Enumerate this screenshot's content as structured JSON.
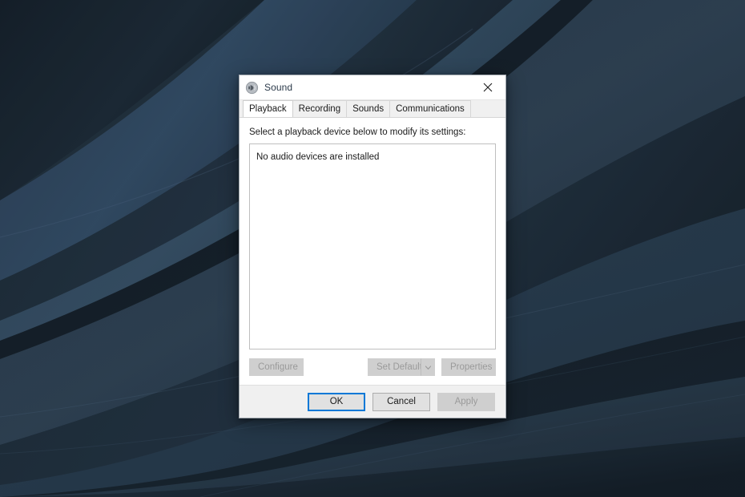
{
  "desktop": {
    "wallpaper_name": "dark-blue-abstract-waves",
    "colors": {
      "base": "#22303f",
      "band_dark": "#182430",
      "band_mid": "#2b3b4d",
      "band_light": "#3b5169",
      "band_deep": "#141e29",
      "highlight": "#4a6party"
    }
  },
  "dialog": {
    "title": "Sound",
    "title_icon": "speaker-icon",
    "close_icon": "close-icon",
    "tabs": [
      {
        "label": "Playback",
        "active": true
      },
      {
        "label": "Recording",
        "active": false
      },
      {
        "label": "Sounds",
        "active": false
      },
      {
        "label": "Communications",
        "active": false
      }
    ],
    "instruction": "Select a playback device below to modify its settings:",
    "device_list": {
      "empty_message": "No audio devices are installed",
      "items": []
    },
    "actions": {
      "configure_label": "Configure",
      "configure_disabled": true,
      "set_default_label": "Set Default",
      "set_default_disabled": true,
      "set_default_arrow_icon": "chevron-down-icon",
      "properties_label": "Properties",
      "properties_disabled": true
    },
    "footer": {
      "ok_label": "OK",
      "ok_default": true,
      "cancel_label": "Cancel",
      "apply_label": "Apply",
      "apply_disabled": true
    },
    "accent_color": "#0078d7"
  }
}
